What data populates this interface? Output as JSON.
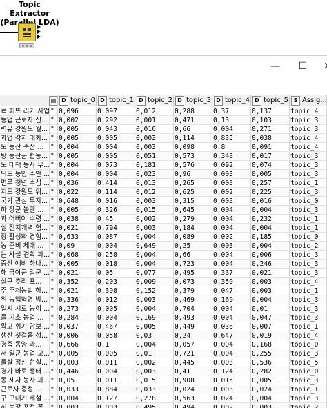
{
  "node": {
    "title_line1": "Topic Extractor",
    "title_line2": "(Parallel LDA)",
    "icon": "lda-node-icon"
  },
  "window": {
    "minimize_glyph": "—",
    "maximize_glyph": "☐",
    "close_glyph": "✕"
  },
  "table": {
    "columns": [
      {
        "type": "D",
        "label": "topic_0"
      },
      {
        "type": "D",
        "label": "topic_1"
      },
      {
        "type": "D",
        "label": "topic_2"
      },
      {
        "type": "D",
        "label": "topic_3"
      },
      {
        "type": "D",
        "label": "topic_4"
      },
      {
        "type": "D",
        "label": "topic_5"
      },
      {
        "type": "S",
        "label": "Assig..."
      }
    ],
    "rows": [
      {
        "doc": "ㄹ 퍼뜨 리기 사업",
        "v": [
          "0,096",
          "0,097",
          "0,012",
          "0,288",
          "0,37",
          "0,137",
          "topic_4"
        ]
      },
      {
        "doc": "농업 근로자 신...",
        "v": [
          "0,002",
          "0,292",
          "0,001",
          "0,471",
          "0,13",
          "0,103",
          "topic_3"
        ]
      },
      {
        "doc": "력유 강원도 월...",
        "v": [
          "0,005",
          "0,043",
          "0,016",
          "0,66",
          "0,004",
          "0,271",
          "topic_3"
        ]
      },
      {
        "doc": "과업 각지 대화...",
        "v": [
          "0,005",
          "0,005",
          "0,003",
          "0,114",
          "0,835",
          "0,038",
          "topic_4"
        ]
      },
      {
        "doc": "도 농산 축산 ...",
        "v": [
          "0,004",
          "0,004",
          "0,003",
          "0,098",
          "0,8",
          "0,091",
          "topic_4"
        ]
      },
      {
        "doc": "탕 농산군 협동...",
        "v": [
          "0,005",
          "0,005",
          "0,051",
          "0,573",
          "0,348",
          "0,017",
          "topic_3"
        ]
      },
      {
        "doc": "도 대책 농사 무...",
        "v": [
          "0,004",
          "0,073",
          "0,181",
          "0,576",
          "0,092",
          "0,074",
          "topic_3"
        ]
      },
      {
        "doc": "되도 농민 주안 ...",
        "v": [
          "0,004",
          "0,004",
          "0,023",
          "0,96",
          "0,003",
          "0,005",
          "topic_3"
        ]
      },
      {
        "doc": "면루 청년 수십 ...",
        "v": [
          "0,036",
          "0,414",
          "0,013",
          "0,265",
          "0,003",
          "0,257",
          "topic_1"
        ]
      },
      {
        "doc": "지도 강원도 위...",
        "v": [
          "0,022",
          "0,114",
          "0,012",
          "0,625",
          "0,002",
          "0,225",
          "topic_3"
        ]
      },
      {
        "doc": "국가 관심 투자...",
        "v": [
          "0,648",
          "0,016",
          "0,003",
          "0,315",
          "0,003",
          "0,016",
          "topic_0"
        ]
      },
      {
        "doc": "하 장군 볼멘 ...",
        "v": [
          "0,005",
          "0,326",
          "0,015",
          "0,645",
          "0,004",
          "0,004",
          "topic_3"
        ]
      },
      {
        "doc": "과 어버이 수령 ...",
        "v": [
          "0,038",
          "0,45",
          "0,002",
          "0,279",
          "0,004",
          "0,232",
          "topic_1"
        ]
      },
      {
        "doc": "실 전지개벽 협...",
        "v": [
          "0,021",
          "0,794",
          "0,003",
          "0,184",
          "0,004",
          "0,004",
          "topic_1"
        ]
      },
      {
        "doc": "장 활성화 경험...",
        "v": [
          "0,633",
          "0,087",
          "0,004",
          "0,089",
          "0,002",
          "0,185",
          "topic_0"
        ]
      },
      {
        "doc": "농 준비 체매 ...",
        "v": [
          "0,09",
          "0,004",
          "0,649",
          "0,25",
          "0,003",
          "0,004",
          "topic_2"
        ]
      },
      {
        "doc": "는 사설 견학 과...",
        "v": [
          "0,068",
          "0,258",
          "0,004",
          "0,66",
          "0,004",
          "0,006",
          "topic_3"
        ]
      },
      {
        "doc": "증산 예비 하나...",
        "v": [
          "0,005",
          "0,018",
          "0,004",
          "0,723",
          "0,004",
          "0,246",
          "topic_3"
        ]
      },
      {
        "doc": "해 금야군 일군 ...",
        "v": [
          "0,021",
          "0,05",
          "0,077",
          "0,495",
          "0,337",
          "0,021",
          "topic_3"
        ]
      },
      {
        "doc": "살구 추리 포...",
        "v": [
          "0,352",
          "0,203",
          "0,009",
          "0,073",
          "0,359",
          "0,003",
          "topic_4"
        ]
      },
      {
        "doc": "주 주체농법 하...",
        "v": [
          "0,021",
          "0,398",
          "0,152",
          "0,379",
          "0,047",
          "0,003",
          "topic_1"
        ]
      },
      {
        "doc": "위 농업혁명 방...",
        "v": [
          "0,336",
          "0,012",
          "0,003",
          "0,469",
          "0,169",
          "0,004",
          "topic_3"
        ]
      },
      {
        "doc": "일시 시로 농이 ...",
        "v": [
          "0,273",
          "0,005",
          "0,004",
          "0,704",
          "0,004",
          "0,01",
          "topic_3"
        ]
      },
      {
        "doc": "을 기초 농업 ...",
        "v": [
          "0,284",
          "0,004",
          "0,169",
          "0,493",
          "0,004",
          "0,047",
          "topic_3"
        ]
      },
      {
        "doc": "확고 휘기 담보 ...",
        "v": [
          "0,037",
          "0,467",
          "0,005",
          "0,449",
          "0,036",
          "0,007",
          "topic_1"
        ]
      },
      {
        "doc": "생산 첫걸음 성...",
        "v": [
          "0,006",
          "0,058",
          "0,03",
          "0,24",
          "0,647",
          "0,019",
          "topic_4"
        ]
      },
      {
        "doc": "경축 동양 과...",
        "v": [
          "0,666",
          "0,1",
          "0,004",
          "0,057",
          "0,004",
          "0,168",
          "topic_0"
        ]
      },
      {
        "doc": "서 일군 농업 고...",
        "v": [
          "0,005",
          "0,005",
          "0,01",
          "0,721",
          "0,004",
          "0,255",
          "topic_3"
        ]
      },
      {
        "doc": "율살 정신 현실...",
        "v": [
          "0,003",
          "0,011",
          "0,002",
          "0,445",
          "0,003",
          "0,536",
          "topic_5"
        ]
      },
      {
        "doc": "경가 바로 생태 ...",
        "v": [
          "0,446",
          "0,004",
          "0,003",
          "0,41",
          "0,124",
          "0,282",
          "topic_0"
        ]
      },
      {
        "doc": "동 세차 농사 과...",
        "v": [
          "0,05",
          "0,011",
          "0,015",
          "0,908",
          "0,015",
          "0,005",
          "topic_3"
        ]
      },
      {
        "doc": "근로자 충정 ...",
        "v": [
          "0,033",
          "0,884",
          "0,033",
          "0,024",
          "0,003",
          "0,024",
          "topic_1"
        ]
      },
      {
        "doc": "구 모내기 제철 ...",
        "v": [
          "0,004",
          "0,127",
          "0,278",
          "0,563",
          "0,024",
          "0,004",
          "topic_3"
        ]
      },
      {
        "doc": "히 농장 포전 폭...",
        "v": [
          "0,003",
          "0,003",
          "0,495",
          "0,494",
          "0,002",
          "0,003",
          "topic_2"
        ]
      }
    ]
  }
}
